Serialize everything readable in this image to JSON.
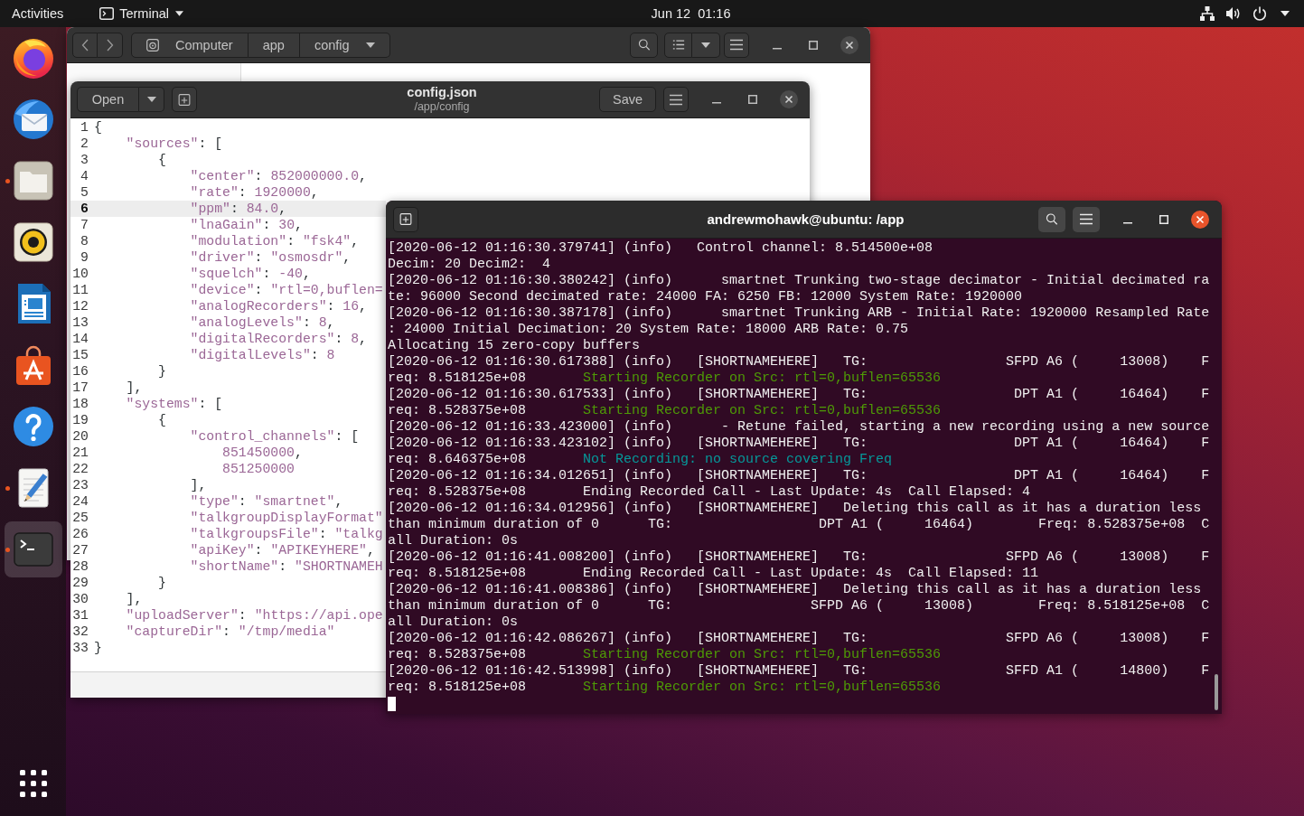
{
  "top_bar": {
    "activities": "Activities",
    "app_menu": "Terminal",
    "clock": "Jun 12  01:16"
  },
  "dock": {
    "items": [
      {
        "kind": "globe",
        "running": false,
        "selected": false
      },
      {
        "kind": "envelope",
        "running": false,
        "selected": false
      },
      {
        "kind": "folder",
        "running": true,
        "selected": false
      },
      {
        "kind": "speaker",
        "running": false,
        "selected": false
      },
      {
        "kind": "document",
        "running": false,
        "selected": false
      },
      {
        "kind": "bag",
        "running": false,
        "selected": false
      },
      {
        "kind": "help",
        "running": false,
        "selected": false
      },
      {
        "kind": "notepad",
        "running": true,
        "selected": false
      },
      {
        "kind": "terminal",
        "running": true,
        "selected": true
      }
    ]
  },
  "file_manager": {
    "path": [
      {
        "label": "Computer",
        "kind": "drive"
      },
      {
        "label": "app",
        "kind": "folder"
      },
      {
        "label": "config",
        "kind": "folder"
      }
    ]
  },
  "editor": {
    "open_button": "Open",
    "title": "config.json",
    "subtitle": "/app/config",
    "save_button": "Save",
    "lines": [
      {
        "number": "1",
        "text": "{",
        "current": false
      },
      {
        "number": "2",
        "text": "    \"sources\": [",
        "current": false
      },
      {
        "number": "3",
        "text": "        {",
        "current": false
      },
      {
        "number": "4",
        "text": "            \"center\": 852000000.0,",
        "current": false
      },
      {
        "number": "5",
        "text": "            \"rate\": 1920000,",
        "current": false
      },
      {
        "number": "6",
        "text": "            \"ppm\": 84.0,",
        "current": true
      },
      {
        "number": "7",
        "text": "            \"lnaGain\": 30,",
        "current": false
      },
      {
        "number": "8",
        "text": "            \"modulation\": \"fsk4\",",
        "current": false
      },
      {
        "number": "9",
        "text": "            \"driver\": \"osmosdr\",",
        "current": false
      },
      {
        "number": "10",
        "text": "            \"squelch\": -40,",
        "current": false
      },
      {
        "number": "11",
        "text": "            \"device\": \"rtl=0,buflen=",
        "current": false
      },
      {
        "number": "12",
        "text": "            \"analogRecorders\": 16,",
        "current": false
      },
      {
        "number": "13",
        "text": "            \"analogLevels\": 8,",
        "current": false
      },
      {
        "number": "14",
        "text": "            \"digitalRecorders\": 8,",
        "current": false
      },
      {
        "number": "15",
        "text": "            \"digitalLevels\": 8",
        "current": false
      },
      {
        "number": "16",
        "text": "        }",
        "current": false
      },
      {
        "number": "17",
        "text": "    ],",
        "current": false
      },
      {
        "number": "18",
        "text": "    \"systems\": [",
        "current": false
      },
      {
        "number": "19",
        "text": "        {",
        "current": false
      },
      {
        "number": "20",
        "text": "            \"control_channels\": [",
        "current": false
      },
      {
        "number": "21",
        "text": "                851450000,",
        "current": false
      },
      {
        "number": "22",
        "text": "                851250000",
        "current": false
      },
      {
        "number": "23",
        "text": "            ],",
        "current": false
      },
      {
        "number": "24",
        "text": "            \"type\": \"smartnet\",",
        "current": false
      },
      {
        "number": "25",
        "text": "            \"talkgroupDisplayFormat\"",
        "current": false
      },
      {
        "number": "26",
        "text": "            \"talkgroupsFile\": \"talkg",
        "current": false
      },
      {
        "number": "27",
        "text": "            \"apiKey\": \"APIKEYHERE\",",
        "current": false
      },
      {
        "number": "28",
        "text": "            \"shortName\": \"SHORTNAMEH",
        "current": false
      },
      {
        "number": "29",
        "text": "        }",
        "current": false
      },
      {
        "number": "30",
        "text": "    ],",
        "current": false
      },
      {
        "number": "31",
        "text": "    \"uploadServer\": \"https://api.ope",
        "current": false
      },
      {
        "number": "32",
        "text": "    \"captureDir\": \"/tmp/media\"",
        "current": false
      },
      {
        "number": "33",
        "text": "}",
        "current": false
      }
    ]
  },
  "terminal": {
    "title": "andrewmohawk@ubuntu: /app",
    "lines": [
      {
        "text": "[2020-06-12 01:16:30.379741] (info)   Control channel: 8.514500e+08"
      },
      {
        "text": "Decim: 20 Decim2:  4"
      },
      {
        "text": "[2020-06-12 01:16:30.380242] (info)      smartnet Trunking two-stage decimator - Initial decimated ra"
      },
      {
        "text": "te: 96000 Second decimated rate: 24000 FA: 6250 FB: 12000 System Rate: 1920000"
      },
      {
        "text": "[2020-06-12 01:16:30.387178] (info)      smartnet Trunking ARB - Initial Rate: 1920000 Resampled Rate"
      },
      {
        "text": ": 24000 Initial Decimation: 20 System Rate: 18000 ARB Rate: 0.75"
      },
      {
        "text": "Allocating 15 zero-copy buffers"
      },
      {
        "text": "[2020-06-12 01:16:30.617388] (info)   [SHORTNAMEHERE]   TG:                 SFPD A6 (     13008)    F"
      },
      {
        "text": "req: 8.518125e+08       ",
        "highlight": {
          "text": "Starting Recorder on Src: rtl=0,buflen=65536",
          "color": "#4e9a06"
        }
      },
      {
        "text": "[2020-06-12 01:16:30.617533] (info)   [SHORTNAMEHERE]   TG:                  DPT A1 (     16464)    F"
      },
      {
        "text": "req: 8.528375e+08       ",
        "highlight": {
          "text": "Starting Recorder on Src: rtl=0,buflen=65536",
          "color": "#4e9a06"
        }
      },
      {
        "text": "[2020-06-12 01:16:33.423000] (info)      - Retune failed, starting a new recording using a new source"
      },
      {
        "text": "[2020-06-12 01:16:33.423102] (info)   [SHORTNAMEHERE]   TG:                  DPT A1 (     16464)    F"
      },
      {
        "text": "req: 8.646375e+08       ",
        "highlight": {
          "text": "Not Recording: no source covering Freq",
          "color": "#06989a"
        }
      },
      {
        "text": "[2020-06-12 01:16:34.012651] (info)   [SHORTNAMEHERE]   TG:                  DPT A1 (     16464)    F"
      },
      {
        "text": "req: 8.528375e+08       Ending Recorded Call - Last Update: 4s  Call Elapsed: 4"
      },
      {
        "text": "[2020-06-12 01:16:34.012956] (info)   [SHORTNAMEHERE]   Deleting this call as it has a duration less"
      },
      {
        "text": "than minimum duration of 0      TG:                  DPT A1 (     16464)        Freq: 8.528375e+08  C"
      },
      {
        "text": "all Duration: 0s"
      },
      {
        "text": "[2020-06-12 01:16:41.008200] (info)   [SHORTNAMEHERE]   TG:                 SFPD A6 (     13008)    F"
      },
      {
        "text": "req: 8.518125e+08       Ending Recorded Call - Last Update: 4s  Call Elapsed: 11"
      },
      {
        "text": "[2020-06-12 01:16:41.008386] (info)   [SHORTNAMEHERE]   Deleting this call as it has a duration less"
      },
      {
        "text": "than minimum duration of 0      TG:                 SFPD A6 (     13008)        Freq: 8.518125e+08  C"
      },
      {
        "text": "all Duration: 0s"
      },
      {
        "text": "[2020-06-12 01:16:42.086267] (info)   [SHORTNAMEHERE]   TG:                 SFPD A6 (     13008)    F"
      },
      {
        "text": "req: 8.528375e+08       ",
        "highlight": {
          "text": "Starting Recorder on Src: rtl=0,buflen=65536",
          "color": "#4e9a06"
        }
      },
      {
        "text": "[2020-06-12 01:16:42.513998] (info)   [SHORTNAMEHERE]   TG:                 SFFD A1 (     14800)    F"
      },
      {
        "text": "req: 8.518125e+08       ",
        "highlight": {
          "text": "Starting Recorder on Src: rtl=0,buflen=65536",
          "color": "#4e9a06"
        }
      }
    ]
  }
}
